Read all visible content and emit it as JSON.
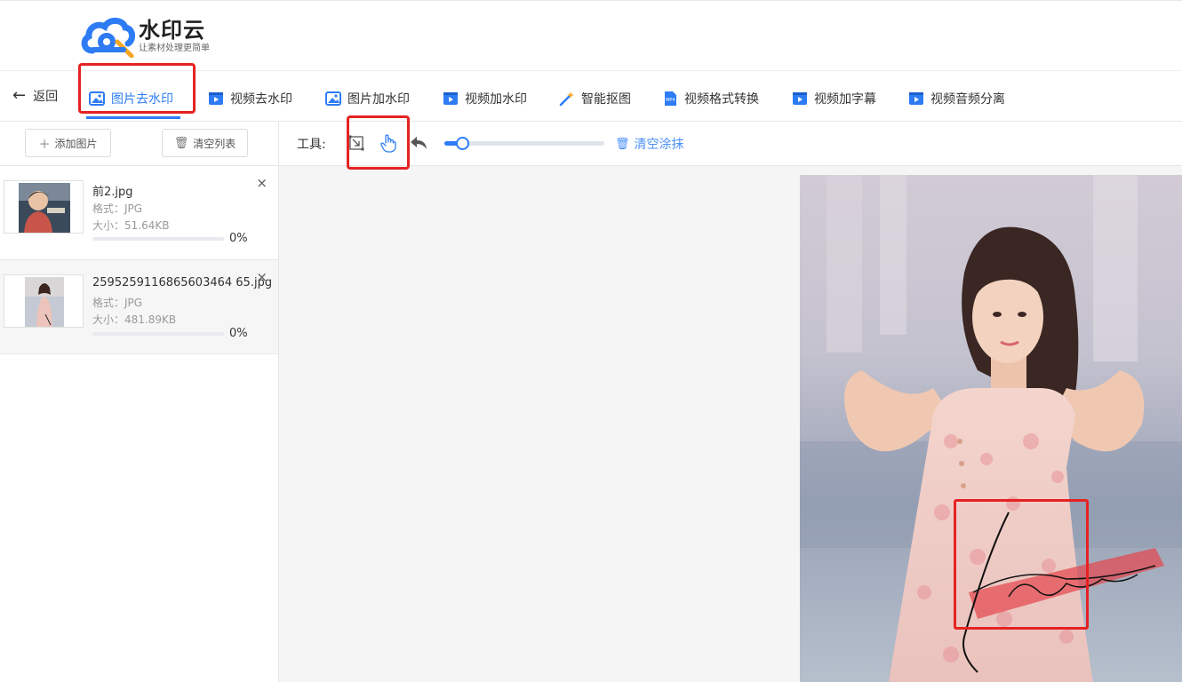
{
  "logo": {
    "title": "水印云",
    "subtitle": "让素材处理更简单"
  },
  "nav": {
    "back_label": "返回",
    "items": [
      {
        "label": "图片去水印",
        "icon": "image-icon",
        "active": true
      },
      {
        "label": "视频去水印",
        "icon": "video-icon"
      },
      {
        "label": "图片加水印",
        "icon": "image-icon"
      },
      {
        "label": "视频加水印",
        "icon": "video-icon"
      },
      {
        "label": "智能抠图",
        "icon": "magic-wand-icon"
      },
      {
        "label": "视频格式转换",
        "icon": "mp4-file-icon"
      },
      {
        "label": "视频加字幕",
        "icon": "video-icon"
      },
      {
        "label": "视频音频分离",
        "icon": "video-icon"
      }
    ]
  },
  "left": {
    "add_label": "添加图片",
    "clear_label": "清空列表",
    "files": [
      {
        "name": "前2.jpg",
        "format": "格式：JPG",
        "size": "大小：51.64KB",
        "progress_pct": 0,
        "progress_label": "0%"
      },
      {
        "name": "2595259116865603464 65.jpg",
        "format": "格式：JPG",
        "size": "大小：481.89KB",
        "progress_pct": 0,
        "progress_label": "0%"
      }
    ]
  },
  "tools": {
    "label": "工具:",
    "brush_size_fraction": 0.11,
    "clear_brush_label": "清空涂抹"
  },
  "colors": {
    "accent": "#2d7cf5",
    "highlight": "#e52222"
  }
}
